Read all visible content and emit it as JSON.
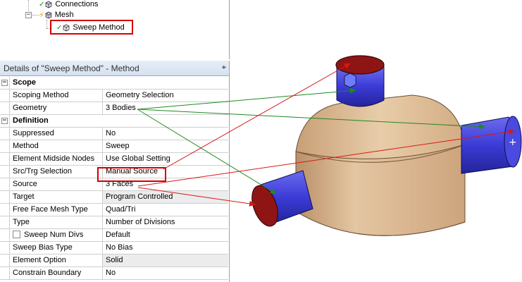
{
  "tree": {
    "items": [
      {
        "label": "Connections"
      },
      {
        "label": "Mesh"
      },
      {
        "label": "Sweep Method"
      }
    ]
  },
  "details": {
    "title": "Details of \"Sweep Method\" - Method",
    "pin_glyph": "⌖",
    "sections": [
      {
        "title": "Scope",
        "rows": [
          {
            "name": "Scoping Method",
            "value": "Geometry Selection"
          },
          {
            "name": "Geometry",
            "value": "3 Bodies"
          }
        ]
      },
      {
        "title": "Definition",
        "rows": [
          {
            "name": "Suppressed",
            "value": "No"
          },
          {
            "name": "Method",
            "value": "Sweep"
          },
          {
            "name": "Element Midside Nodes",
            "value": "Use Global Setting"
          },
          {
            "name": "Src/Trg Selection",
            "value": "Manual Source"
          },
          {
            "name": "Source",
            "value": "3 Faces"
          },
          {
            "name": "Target",
            "value": "Program Controlled"
          },
          {
            "name": "Free Face Mesh Type",
            "value": "Quad/Tri"
          },
          {
            "name": "Type",
            "value": "Number of Divisions"
          },
          {
            "name": "Sweep Num Divs",
            "value": "Default"
          },
          {
            "name": "Sweep Bias Type",
            "value": "No Bias"
          },
          {
            "name": "Element Option",
            "value": "Solid"
          },
          {
            "name": "Constrain Boundary",
            "value": "No"
          }
        ]
      }
    ]
  },
  "colors": {
    "highlight_red": "#d40000",
    "arrow_green": "#1f8a1f",
    "arrow_red": "#d81818",
    "body_tan": "#d9b48c",
    "pipe_blue": "#3b3bd6",
    "face_red": "#9c1414"
  }
}
